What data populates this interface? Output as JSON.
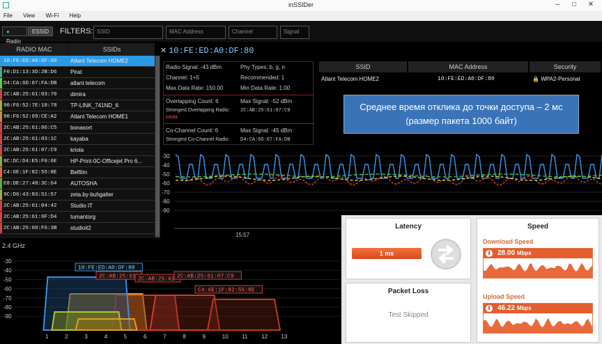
{
  "window": {
    "title": "inSSIDer",
    "minimize": "–",
    "maximize": "□",
    "close": "✕"
  },
  "menu": [
    "File",
    "View",
    "Wi-Fi",
    "Help"
  ],
  "toolbar": {
    "radio_label": "Radio",
    "essid_label": "ESSID",
    "filters_label": "FILTERS:",
    "filters": [
      {
        "name": "ssid",
        "placeholder": "SSID"
      },
      {
        "name": "mac",
        "placeholder": "MAC Address"
      },
      {
        "name": "channel",
        "placeholder": "Channel"
      },
      {
        "name": "signal",
        "placeholder": "Signal"
      }
    ]
  },
  "network_list": {
    "headers": {
      "mac": "RADIO MAC",
      "ssid": "SSIDs"
    },
    "rows": [
      {
        "mac": "10:FE:ED:A0:DF:80",
        "ssid": "Atlant Telecom HOME2",
        "color": "#2a9ae8",
        "selected": true
      },
      {
        "mac": "F0:D1:13:3D:2B:D6",
        "ssid": "Pirat",
        "color": "#4a8"
      },
      {
        "mac": "D4:CA:6D:07:FA:DB",
        "ssid": "atlant telecom",
        "color": "#6c4"
      },
      {
        "mac": "2C:AB:25:61:03:70",
        "ssid": "dimira",
        "color": "#c44"
      },
      {
        "mac": "90:F6:52:7E:18:78",
        "ssid": "TP-LINK_741ND_6",
        "color": "#aa4"
      },
      {
        "mac": "90:F6:52:69:CE:A2",
        "ssid": "Atlant Telecom HOME1",
        "color": "#c84"
      },
      {
        "mac": "2C:AB:25:61:06:C5",
        "ssid": "bonasort",
        "color": "#c44"
      },
      {
        "mac": "2C:AB:25:61:03:1C",
        "ssid": "kayaba",
        "color": "#c44"
      },
      {
        "mac": "2C:AB:25:61:07:C9",
        "ssid": "kriola",
        "color": "#c44"
      },
      {
        "mac": "8C:DC:D4:E5:F0:6E",
        "ssid": "HP-Print-0C-Officejet Pro 6...",
        "color": "#8a4"
      },
      {
        "mac": "C4:6E:1F:82:55:8E",
        "ssid": "Belfilm",
        "color": "#d64"
      },
      {
        "mac": "E8:DE:27:48:3C:64",
        "ssid": "AUTOSHA",
        "color": "#6a4"
      },
      {
        "mac": "9C:D6:43:83:51:57",
        "ssid": "zeta.by-buhgalter",
        "color": "#aa4"
      },
      {
        "mac": "2C:AB:25:61:04:42",
        "ssid": "Studio IT",
        "color": "#c44"
      },
      {
        "mac": "2C:AB:25:61:6F:D4",
        "ssid": "tumantorg",
        "color": "#c44"
      },
      {
        "mac": "2C:AB:25:60:F6:3B",
        "ssid": "studioit2",
        "color": "#c44"
      }
    ]
  },
  "detail": {
    "close": "✕",
    "title": "10:FE:ED:A0:DF:80",
    "radio_signal": "Radio Signal: -43 dBm",
    "phy_types": "Phy Types: b, g, n",
    "channel": "Channel: 1+5",
    "recommended": "Recommended: 1",
    "max_rate": "Max Data Rate: 150.00",
    "min_rate": "Min Data Rate: 1.00",
    "overlap_count": "Overlapping Count: 6",
    "overlap_max": "Max Signal: -52 dBm",
    "overlap_strongest_label": "Strongest Overlapping Radio:",
    "overlap_strongest_mac": "2C:AB:25:61:07:C9",
    "overlap_strongest_ssid": "kriola",
    "cochan_count": "Co-Channel Count: 6",
    "cochan_max": "Max Signal: -45 dBm",
    "cochan_strongest_label": "Strongest Co-Channel Radio:",
    "cochan_strongest_mac": "D4:CA:6D:07:FA:DB",
    "table": {
      "headers": [
        "SSID",
        "MAC Address",
        "Security"
      ],
      "row": [
        "Atlant Telecom HOME2",
        "10:FE:ED:A0:DF:80",
        "WPA2-Personal"
      ]
    },
    "note": "Среднее время отклика до точки доступа – 2 мс (размер пакета 1000 байт)"
  },
  "time_graph": {
    "y_ticks": [
      "-30",
      "-40",
      "-50",
      "-60",
      "-70",
      "-80",
      "-90"
    ],
    "x_label": "15:57",
    "colors": {
      "signal": "#3a8fe0",
      "red": "#d63a2a",
      "yellow": "#d8c840",
      "green": "#4caf50"
    }
  },
  "channel_graph": {
    "band": "2.4 GHz",
    "y_ticks": [
      "-30",
      "-40",
      "-50",
      "-60",
      "-70",
      "-80",
      "-90"
    ],
    "x_ticks": [
      "1",
      "2",
      "3",
      "4",
      "5",
      "6",
      "7",
      "8",
      "9",
      "10",
      "11",
      "12",
      "13"
    ],
    "labels": [
      {
        "text": "10:FE:ED:A0:DF:80",
        "color": "#3a8fe0"
      },
      {
        "text": "2C:AB:25:61",
        "color": "#d63a2a"
      },
      {
        "text": "2C:AB:25:61",
        "color": "#d63a2a"
      },
      {
        "text": "2C:AB:25:61:07:C9",
        "color": "#d63a2a"
      },
      {
        "text": "C4:6E:1F:82:55:8E",
        "color": "#d63a2a"
      }
    ]
  },
  "speedtest": {
    "latency_title": "Latency",
    "latency_value": "1 ms",
    "packet_loss_title": "Packet Loss",
    "packet_loss_value": "Test Skipped",
    "speed_title": "Speed",
    "download_label": "Download Speed",
    "download_value": "28.00",
    "download_unit": "Mbps",
    "upload_label": "Upload Speed",
    "upload_value": "46.22",
    "upload_unit": "Mbps"
  }
}
